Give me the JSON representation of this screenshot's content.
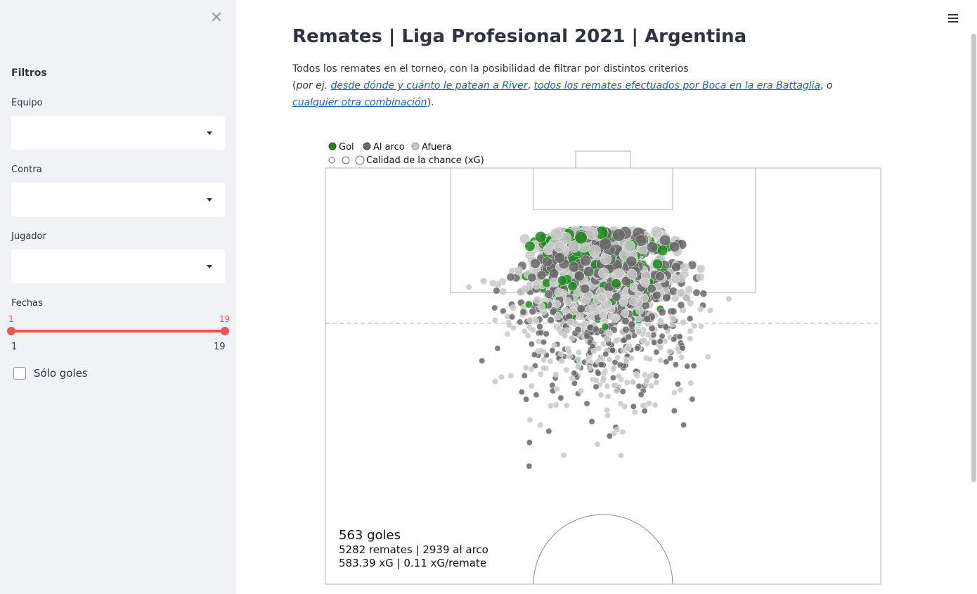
{
  "sidebar": {
    "close_icon": "close-icon",
    "heading": "Filtros",
    "fields": [
      {
        "label": "Equipo",
        "value": ""
      },
      {
        "label": "Contra",
        "value": ""
      },
      {
        "label": "Jugador",
        "value": ""
      }
    ],
    "fechas": {
      "label": "Fechas",
      "low": "1",
      "high": "19",
      "min_label": "1",
      "max_label": "19"
    },
    "solo_goles": {
      "label": "Sólo goles",
      "checked": false
    }
  },
  "header": {
    "menu_icon": "hamburger-icon"
  },
  "main": {
    "title": "Remates | Liga Profesional 2021 | Argentina",
    "desc_line1": "Todos los remates en el torneo, con la posibilidad de filtrar por distintos criterios",
    "desc_open": "(",
    "desc_porej": "por ej.",
    "link1": "desde dónde y cuánto le patean a River",
    "sep1": ",",
    "link2": "todos los remates efectuados por Boca en la era Battaglia",
    "sep2": ",",
    "desc_o": "o",
    "link3": "cualquier otra combinación",
    "desc_close": ")."
  },
  "chart_data": {
    "type": "scatter",
    "legend": {
      "placement": "top-left",
      "outcomes": [
        {
          "name": "Gol",
          "color": "#1f8a1f"
        },
        {
          "name": "Al arco",
          "color": "#686868"
        },
        {
          "name": "Afuera",
          "color": "#c8c8c8"
        }
      ],
      "size_label": "Calidad de la chance (xG)"
    },
    "summary": {
      "goals_line": "563 goles",
      "shots_line": "5282 remates | 2939 al arco",
      "xg_line": "583.39 xG | 0.11 xG/remate"
    },
    "totals": {
      "goles": 563,
      "remates": 5282,
      "al_arco": 2939,
      "xg": 583.39,
      "xg_por_remate": 0.11
    }
  }
}
